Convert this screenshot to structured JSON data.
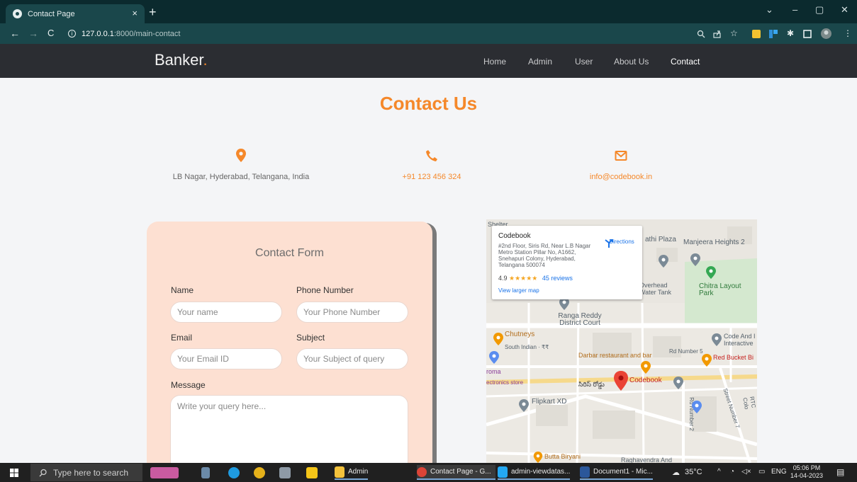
{
  "browser": {
    "tab_title": "Contact Page",
    "tab_close": "×",
    "new_tab": "+",
    "url_host": "127.0.0.1",
    "url_path": ":8000/main-contact",
    "window_controls": [
      "⌄",
      "–",
      "▢",
      "✕"
    ]
  },
  "site": {
    "brand": "Banker",
    "brand_dot": ".",
    "nav": [
      "Home",
      "Admin",
      "User",
      "About Us",
      "Contact"
    ],
    "active_nav": "Contact"
  },
  "page": {
    "title": "Contact Us",
    "address": "LB Nagar, Hyderabad, Telangana, India",
    "phone": "+91 123 456 324",
    "email": "info@codebook.in"
  },
  "form": {
    "title": "Contact Form",
    "name_label": "Name",
    "name_placeholder": "Your name",
    "phone_label": "Phone Number",
    "phone_placeholder": "Your Phone Number",
    "email_label": "Email",
    "email_placeholder": "Your Email ID",
    "subject_label": "Subject",
    "subject_placeholder": "Your Subject of query",
    "message_label": "Message",
    "message_placeholder": "Write your query here..."
  },
  "map": {
    "place_name": "Codebook",
    "place_address": "#2nd Floor, Siris Rd, Near L.B Nagar Metro Station Pillar No, A1662, Snehapuri Colony, Hyderabad, Telangana 500074",
    "rating": "4.9",
    "stars": "★★★★★",
    "reviews": "45 reviews",
    "view_larger": "View larger map",
    "directions": "Directions",
    "labels": {
      "shelter": "Shelter",
      "plaza": "athi Plaza",
      "manjeera": "Manjeera Heights 2",
      "overhead": "Overhead Water Tank",
      "chitra": "Chitra Layout Park",
      "court": "Ranga Reddy District Court",
      "chutneys": "Chutneys",
      "south_indian": "South Indian · ₹₹",
      "code_and": "Code And I Interactive",
      "darbar": "Darbar restaurant and bar",
      "rd5": "Rd Number 5",
      "red_bucket": "Red Bucket Bi",
      "croma": "roma",
      "electronics": "ectronics store",
      "siris": "సిరిస్ రోడ్డు",
      "codebook_pin": "Codebook",
      "flipkart": "Flipkart XD",
      "butta": "Butta Biryani",
      "raghavendra": "Raghavendra And",
      "rd2": "Rd Number 2",
      "street7": "Street Number 7",
      "rtc": "RTC Colo"
    }
  },
  "taskbar": {
    "search_placeholder": "Type here to search",
    "apps": [
      "Admin",
      "Contact Page - G...",
      "admin-viewdatas...",
      "Document1 - Mic..."
    ],
    "weather": "35°C",
    "lang": "ENG",
    "time": "05:06 PM",
    "date": "14-04-2023"
  }
}
